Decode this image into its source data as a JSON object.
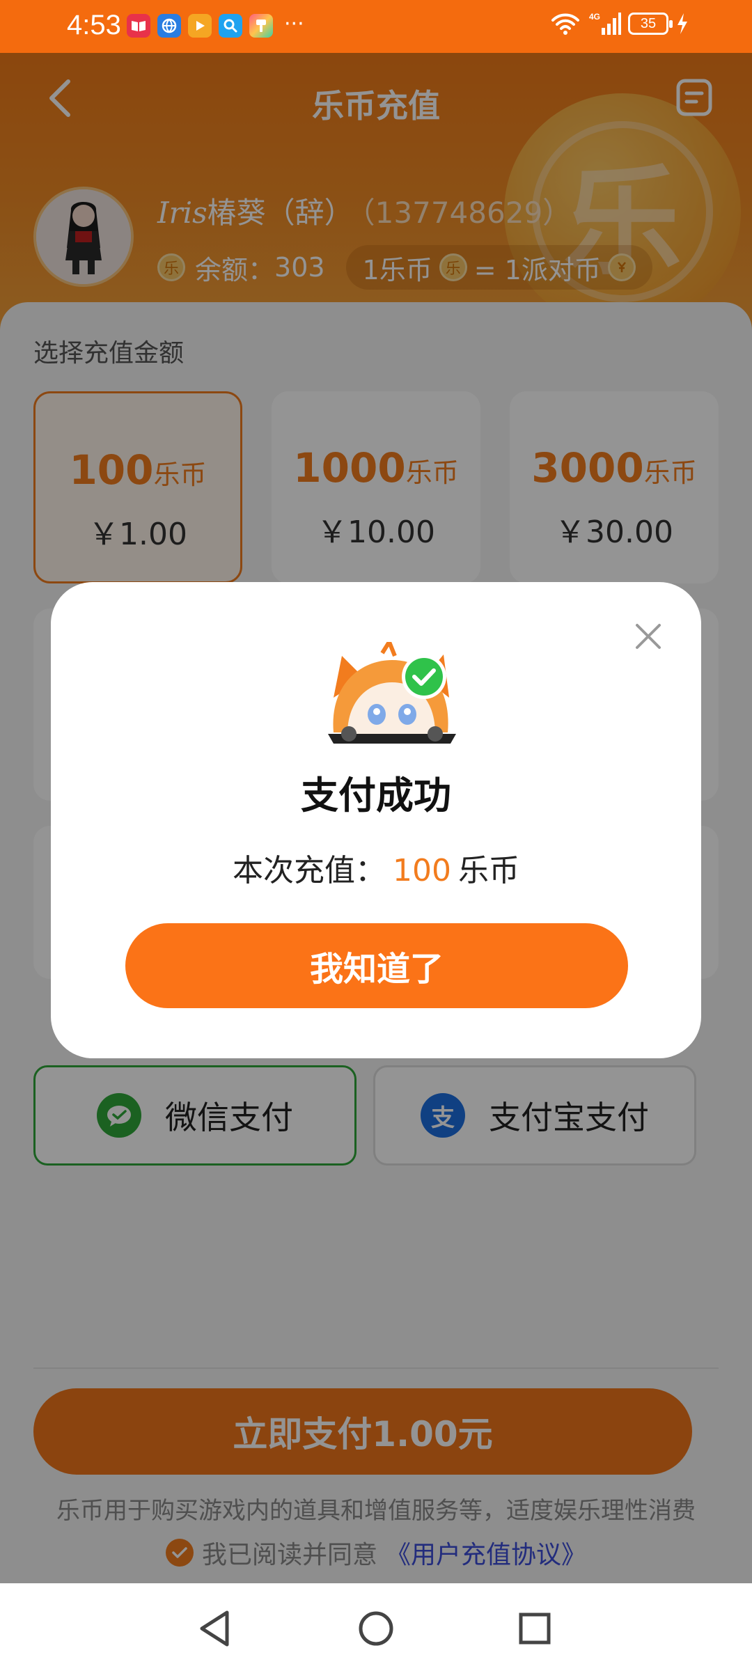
{
  "status_bar": {
    "time": "4:53",
    "battery": "35",
    "network": "4G"
  },
  "header": {
    "title": "乐币充值",
    "user": {
      "name_script": "Iris",
      "name": "椿葵（辞）",
      "id": "（137748629）"
    },
    "balance_label": "余额：",
    "balance_value": "303",
    "rate_left": "1乐币",
    "rate_right": "= 1派对币",
    "deco_char": "乐",
    "coin_char": "乐"
  },
  "recharge": {
    "section_label": "选择充值金额",
    "packages": [
      {
        "amount": "100",
        "unit": "乐币",
        "price": "￥1.00",
        "selected": true
      },
      {
        "amount": "1000",
        "unit": "乐币",
        "price": "￥10.00",
        "selected": false
      },
      {
        "amount": "3000",
        "unit": "乐币",
        "price": "￥30.00",
        "selected": false
      }
    ]
  },
  "payment": {
    "wechat_label": "微信支付",
    "alipay_label": "支付宝支付",
    "alipay_glyph": "支",
    "pay_button": "立即支付1.00元",
    "tip": "乐币用于购买游戏内的道具和增值服务等，适度娱乐理性消费",
    "agree_text": "我已阅读并同意",
    "agree_link": "《用户充值协议》"
  },
  "dialog": {
    "title": "支付成功",
    "message_prefix": "本次充值：",
    "amount": "100",
    "unit": "乐币",
    "confirm_button": "我知道了"
  },
  "colors": {
    "accent": "#f27c1e",
    "status_bar": "#f46b0e",
    "wechat": "#2fa83a",
    "alipay": "#1c6fe0",
    "link": "#3c4dd8"
  }
}
